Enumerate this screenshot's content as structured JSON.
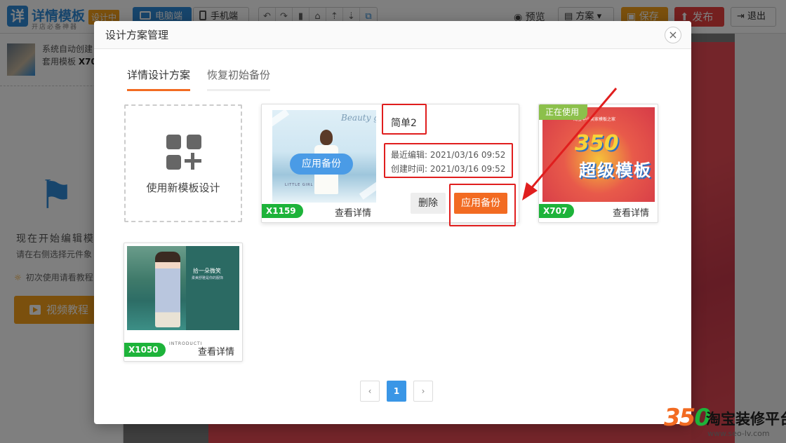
{
  "topbar": {
    "logo_mark": "详",
    "logo_title": "详情模板",
    "logo_sub": "开店必备神器",
    "designing_tag": "设计中",
    "pc_label": "电脑端",
    "mobile_label": "手机端",
    "tools": [
      "↶",
      "↷",
      "▮",
      "⌂",
      "⇡",
      "⇣",
      "⧉"
    ],
    "preview_label": "预览",
    "scheme_label": "方案",
    "save_label": "保存",
    "publish_label": "发布",
    "exit_label": "退出"
  },
  "left_panel": {
    "line1": "系统自动创建",
    "line2_prefix": "套用模板",
    "line2_code": "X70",
    "heading": "现在开始编辑模",
    "hint": "请在右侧选择元件象",
    "tip": "初次使用请看教程",
    "video_label": "视频教程"
  },
  "modal": {
    "title": "设计方案管理",
    "close_symbol": "×",
    "tabs": [
      {
        "label": "详情设计方案",
        "active": true
      },
      {
        "label": "恢复初始备份",
        "active": false
      }
    ],
    "new_design_label": "使用新模板设计",
    "main_card": {
      "name": "简单2",
      "last_edit_label": "最近编辑:",
      "last_edit_value": "2021/03/16 09:52",
      "created_label": "创建时间:",
      "created_value": "2021/03/16 09:52",
      "code": "X1159",
      "detail_label": "查看详情",
      "apply_overlay_label": "应用备份",
      "delete_label": "删除",
      "apply_label": "应用备份",
      "thumb_script": "Beauty girl",
      "thumb_caption": "LITTLE GIRL"
    },
    "card_707": {
      "in_use_label": "正在使用",
      "code": "X707",
      "detail_label": "查看详情",
      "thumb_big": "350",
      "thumb_big2": "超级模板",
      "thumb_top": "淘宝中小卖家模板之家"
    },
    "card_1050": {
      "code": "X1050",
      "detail_label": "查看详情",
      "thumb_title": "拾一朵微笑",
      "thumb_sub": "柔美舒雅是你的服饰",
      "intro": "INTRODUCTI"
    },
    "pagination": {
      "prev": "‹",
      "current": "1",
      "next": "›"
    }
  },
  "watermark": {
    "num_a": "35",
    "num_b": "0",
    "text": "淘宝装修平台",
    "url": "www.seo-lv.com"
  },
  "colors": {
    "accent_blue": "#2f8bd8",
    "orange": "#f26b22",
    "green_badge": "#1db33a",
    "highlight_red": "#e01e1e"
  }
}
